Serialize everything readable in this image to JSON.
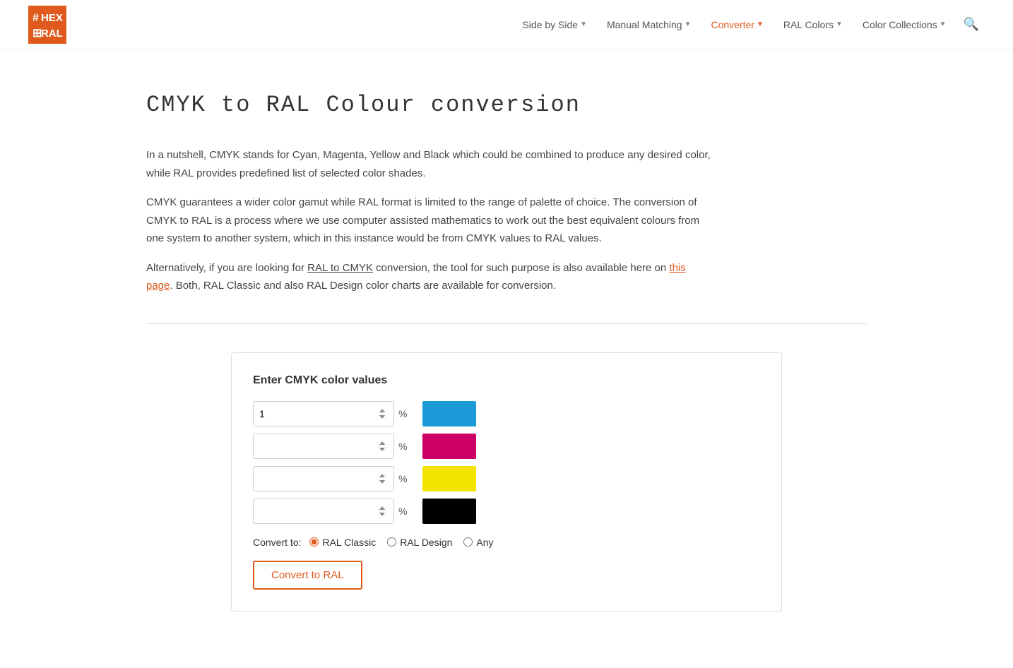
{
  "logo": {
    "alt": "HexToRAL Logo",
    "hash_color": "#e05a1e",
    "text": "HEX\nRAL"
  },
  "nav": {
    "items": [
      {
        "label": "Side by Side",
        "has_chevron": true,
        "active": false
      },
      {
        "label": "Manual Matching",
        "has_chevron": true,
        "active": false
      },
      {
        "label": "Converter",
        "has_chevron": true,
        "active": true
      },
      {
        "label": "RAL Colors",
        "has_chevron": true,
        "active": false
      },
      {
        "label": "Color Collections",
        "has_chevron": true,
        "active": false
      }
    ]
  },
  "page": {
    "title": "CMYK to RAL Colour conversion",
    "para1": "In a nutshell, CMYK stands for Cyan, Magenta, Yellow and Black which could be combined to produce any desired color, while RAL provides predefined list of selected color shades.",
    "para2": "CMYK guarantees a wider color gamut while RAL format is limited to the range of palette of choice. The conversion of CMYK to RAL is a process where we use computer assisted mathematics to work out the best equivalent colours from one system to another system, which in this instance would be from CMYK values to RAL values.",
    "para3_pre": "Alternatively, if you are looking for ",
    "para3_link1_label": "RAL to CMYK",
    "para3_mid": " conversion, the tool for such purpose is also available here on ",
    "para3_link2_label": "this page",
    "para3_post": ". Both, RAL Classic and also RAL Design color charts are available for conversion."
  },
  "converter": {
    "heading": "Enter CMYK color values",
    "fields": [
      {
        "id": "cyan",
        "placeholder": "1",
        "percent": "%",
        "swatch_color": "#1b9cd8"
      },
      {
        "id": "magenta",
        "placeholder": "",
        "percent": "%",
        "swatch_color": "#cc0066"
      },
      {
        "id": "yellow",
        "placeholder": "",
        "percent": "%",
        "swatch_color": "#f5e400"
      },
      {
        "id": "black",
        "placeholder": "",
        "percent": "%",
        "swatch_color": "#000000"
      }
    ],
    "convert_to_label": "Convert to:",
    "radio_options": [
      {
        "label": "RAL Classic",
        "value": "classic",
        "checked": true
      },
      {
        "label": "RAL Design",
        "value": "design",
        "checked": false
      },
      {
        "label": "Any",
        "value": "any",
        "checked": false
      }
    ],
    "button_label": "Convert to RAL"
  }
}
